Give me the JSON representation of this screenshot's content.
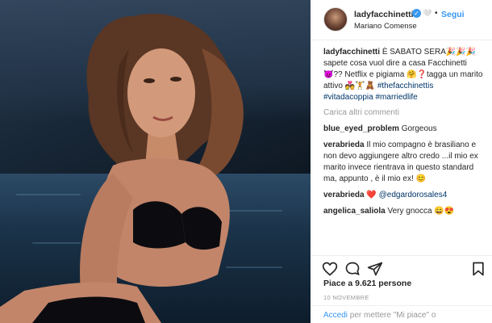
{
  "post": {
    "username": "ladyfacchinetti",
    "verified_icon": "verified-badge-icon",
    "header_emoji": "🤍",
    "separator": "•",
    "follow_label": "Segui",
    "location": "Mariano Comense"
  },
  "caption": {
    "username": "ladyfacchinetti",
    "text": "È SABATO SERA🎉🎉🎉 sapete cosa vuol dire a casa Facchinetti 😈?? Netflix e pigiama 🤗❓tagga un marito attivo 💑🏋🧸",
    "hashtags": "#thefacchinettis #vitadacoppia #marriedlife"
  },
  "load_more_label": "Carica altri commenti",
  "comments": [
    {
      "username": "blue_eyed_problem",
      "text": "Gorgeous"
    },
    {
      "username": "verabrieda",
      "text": "Il mio compagno è brasiliano e non devo aggiungere altro credo ...il mio ex marito invece rientrava in questo standard ma, appunto , è il mio ex! 😊"
    },
    {
      "username": "verabrieda",
      "text": "❤️",
      "mention": "@edgardorosales4"
    },
    {
      "username": "angelica_saliola",
      "text": "Very gnocca 😄😍"
    }
  ],
  "actions": {
    "like_icon": "heart-icon",
    "comment_icon": "comment-icon",
    "share_icon": "share-icon",
    "save_icon": "bookmark-icon"
  },
  "likes_text": "Piace a 9.621 persone",
  "date_text": "10 NOVEMBRE",
  "login_prompt": {
    "link": "Accedi",
    "text": "per mettere \"Mi piace\" o"
  }
}
